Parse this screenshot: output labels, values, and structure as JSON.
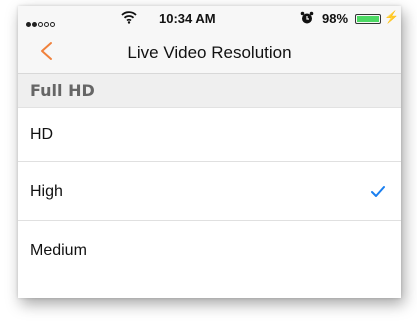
{
  "status_bar": {
    "time": "10:34 AM",
    "battery_percent": "98%",
    "battery_level": 0.98,
    "signal_bars_filled": 2,
    "signal_bars_total": 5,
    "icons": [
      "signal-dots-icon",
      "wifi-icon",
      "alarm-clock-icon",
      "battery-icon",
      "charging-bolt-icon"
    ]
  },
  "nav": {
    "title": "Live Video Resolution",
    "back_icon": "chevron-left-icon"
  },
  "colors": {
    "accent_back": "#f0813c",
    "checkmark": "#1a7ff0",
    "battery_fill": "#4cd964"
  },
  "section": {
    "header": "Full HD"
  },
  "options": [
    {
      "label": "HD",
      "selected": false
    },
    {
      "label": "High",
      "selected": true
    },
    {
      "label": "Medium",
      "selected": false
    }
  ]
}
